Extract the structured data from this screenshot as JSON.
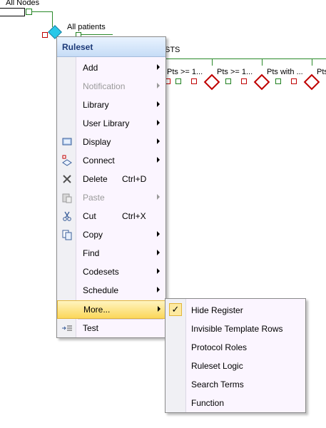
{
  "tree": {
    "all_nodes_label": "All Nodes",
    "all_patients_label": "All patients",
    "sts_label": "STS",
    "rule_nodes": [
      {
        "label": "Pts >= 1..."
      },
      {
        "label": "Pts >= 1..."
      },
      {
        "label": "Pts with ..."
      },
      {
        "label": "Pts"
      }
    ]
  },
  "context_menu": {
    "title": "Ruleset",
    "items": [
      {
        "label": "Add",
        "submenu": true,
        "disabled": false
      },
      {
        "label": "Notification",
        "submenu": true,
        "disabled": true
      },
      {
        "label": "Library",
        "submenu": true,
        "disabled": false
      },
      {
        "label": "User Library",
        "submenu": true,
        "disabled": false
      },
      {
        "label": "Display",
        "submenu": true,
        "disabled": false,
        "icon": "display-icon"
      },
      {
        "label": "Connect",
        "submenu": true,
        "disabled": false,
        "icon": "connect-icon"
      },
      {
        "label": "Delete",
        "shortcut": "Ctrl+D",
        "disabled": false,
        "icon": "delete-icon"
      },
      {
        "label": "Paste",
        "submenu": true,
        "disabled": true,
        "icon": "paste-icon"
      },
      {
        "label": "Cut",
        "shortcut": "Ctrl+X",
        "disabled": false,
        "icon": "scissors-icon"
      },
      {
        "label": "Copy",
        "submenu": true,
        "disabled": false,
        "icon": "copy-icon"
      },
      {
        "label": "Find",
        "submenu": true,
        "disabled": false
      },
      {
        "label": "Codesets",
        "submenu": true,
        "disabled": false
      },
      {
        "label": "Schedule",
        "submenu": true,
        "disabled": false
      },
      {
        "label": "More...",
        "submenu": true,
        "disabled": false,
        "highlighted": true
      },
      {
        "label": "Test",
        "disabled": false,
        "icon": "test-icon"
      }
    ]
  },
  "more_submenu": {
    "items": [
      {
        "label": "Hide Register",
        "checked": true
      },
      {
        "label": "Invisible Template Rows"
      },
      {
        "label": "Protocol Roles"
      },
      {
        "label": "Ruleset Logic"
      },
      {
        "label": "Search Terms"
      },
      {
        "label": "Function"
      }
    ]
  },
  "colors": {
    "connector": "#2a8a2a",
    "node_border": "#c00000",
    "menu_bg": "#fbf5ff",
    "highlight": "#fbd75a",
    "header": "#c6dcf6"
  }
}
